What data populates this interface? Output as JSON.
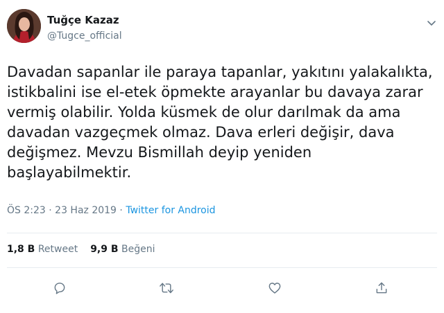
{
  "tweet": {
    "author_name": "Tuğçe Kazaz",
    "author_handle": "@Tugce_official",
    "text_lines": [
      "Davadan sapanlar ile paraya tapanlar, yakıtını yalakalıkta,",
      "istikbalini ise el-etek öpmekte arayanlar bu davaya zarar",
      "vermiş olabilir. Yolda küsmek de olur darılmak da ama",
      "davadan vazgeçmek olmaz. Dava erleri değişir, dava",
      "değişmez. Mevzu Bismillah deyip yeniden",
      "başlayabilmektir."
    ],
    "time": "ÖS 2:23",
    "separator": " · ",
    "date": "23 Haz 2019",
    "source": "Twitter for Android",
    "retweet_count": "1,8 B",
    "retweet_label": "Retweet",
    "like_count": "9,9 B",
    "like_label": "Beğeni"
  },
  "icons": {
    "more": "chevron-down-icon",
    "reply": "reply-icon",
    "retweet": "retweet-icon",
    "like": "heart-icon",
    "share": "share-icon"
  },
  "colors": {
    "text": "#14171a",
    "secondary": "#657786",
    "link": "#1b95e0",
    "divider": "#e6ecf0"
  }
}
